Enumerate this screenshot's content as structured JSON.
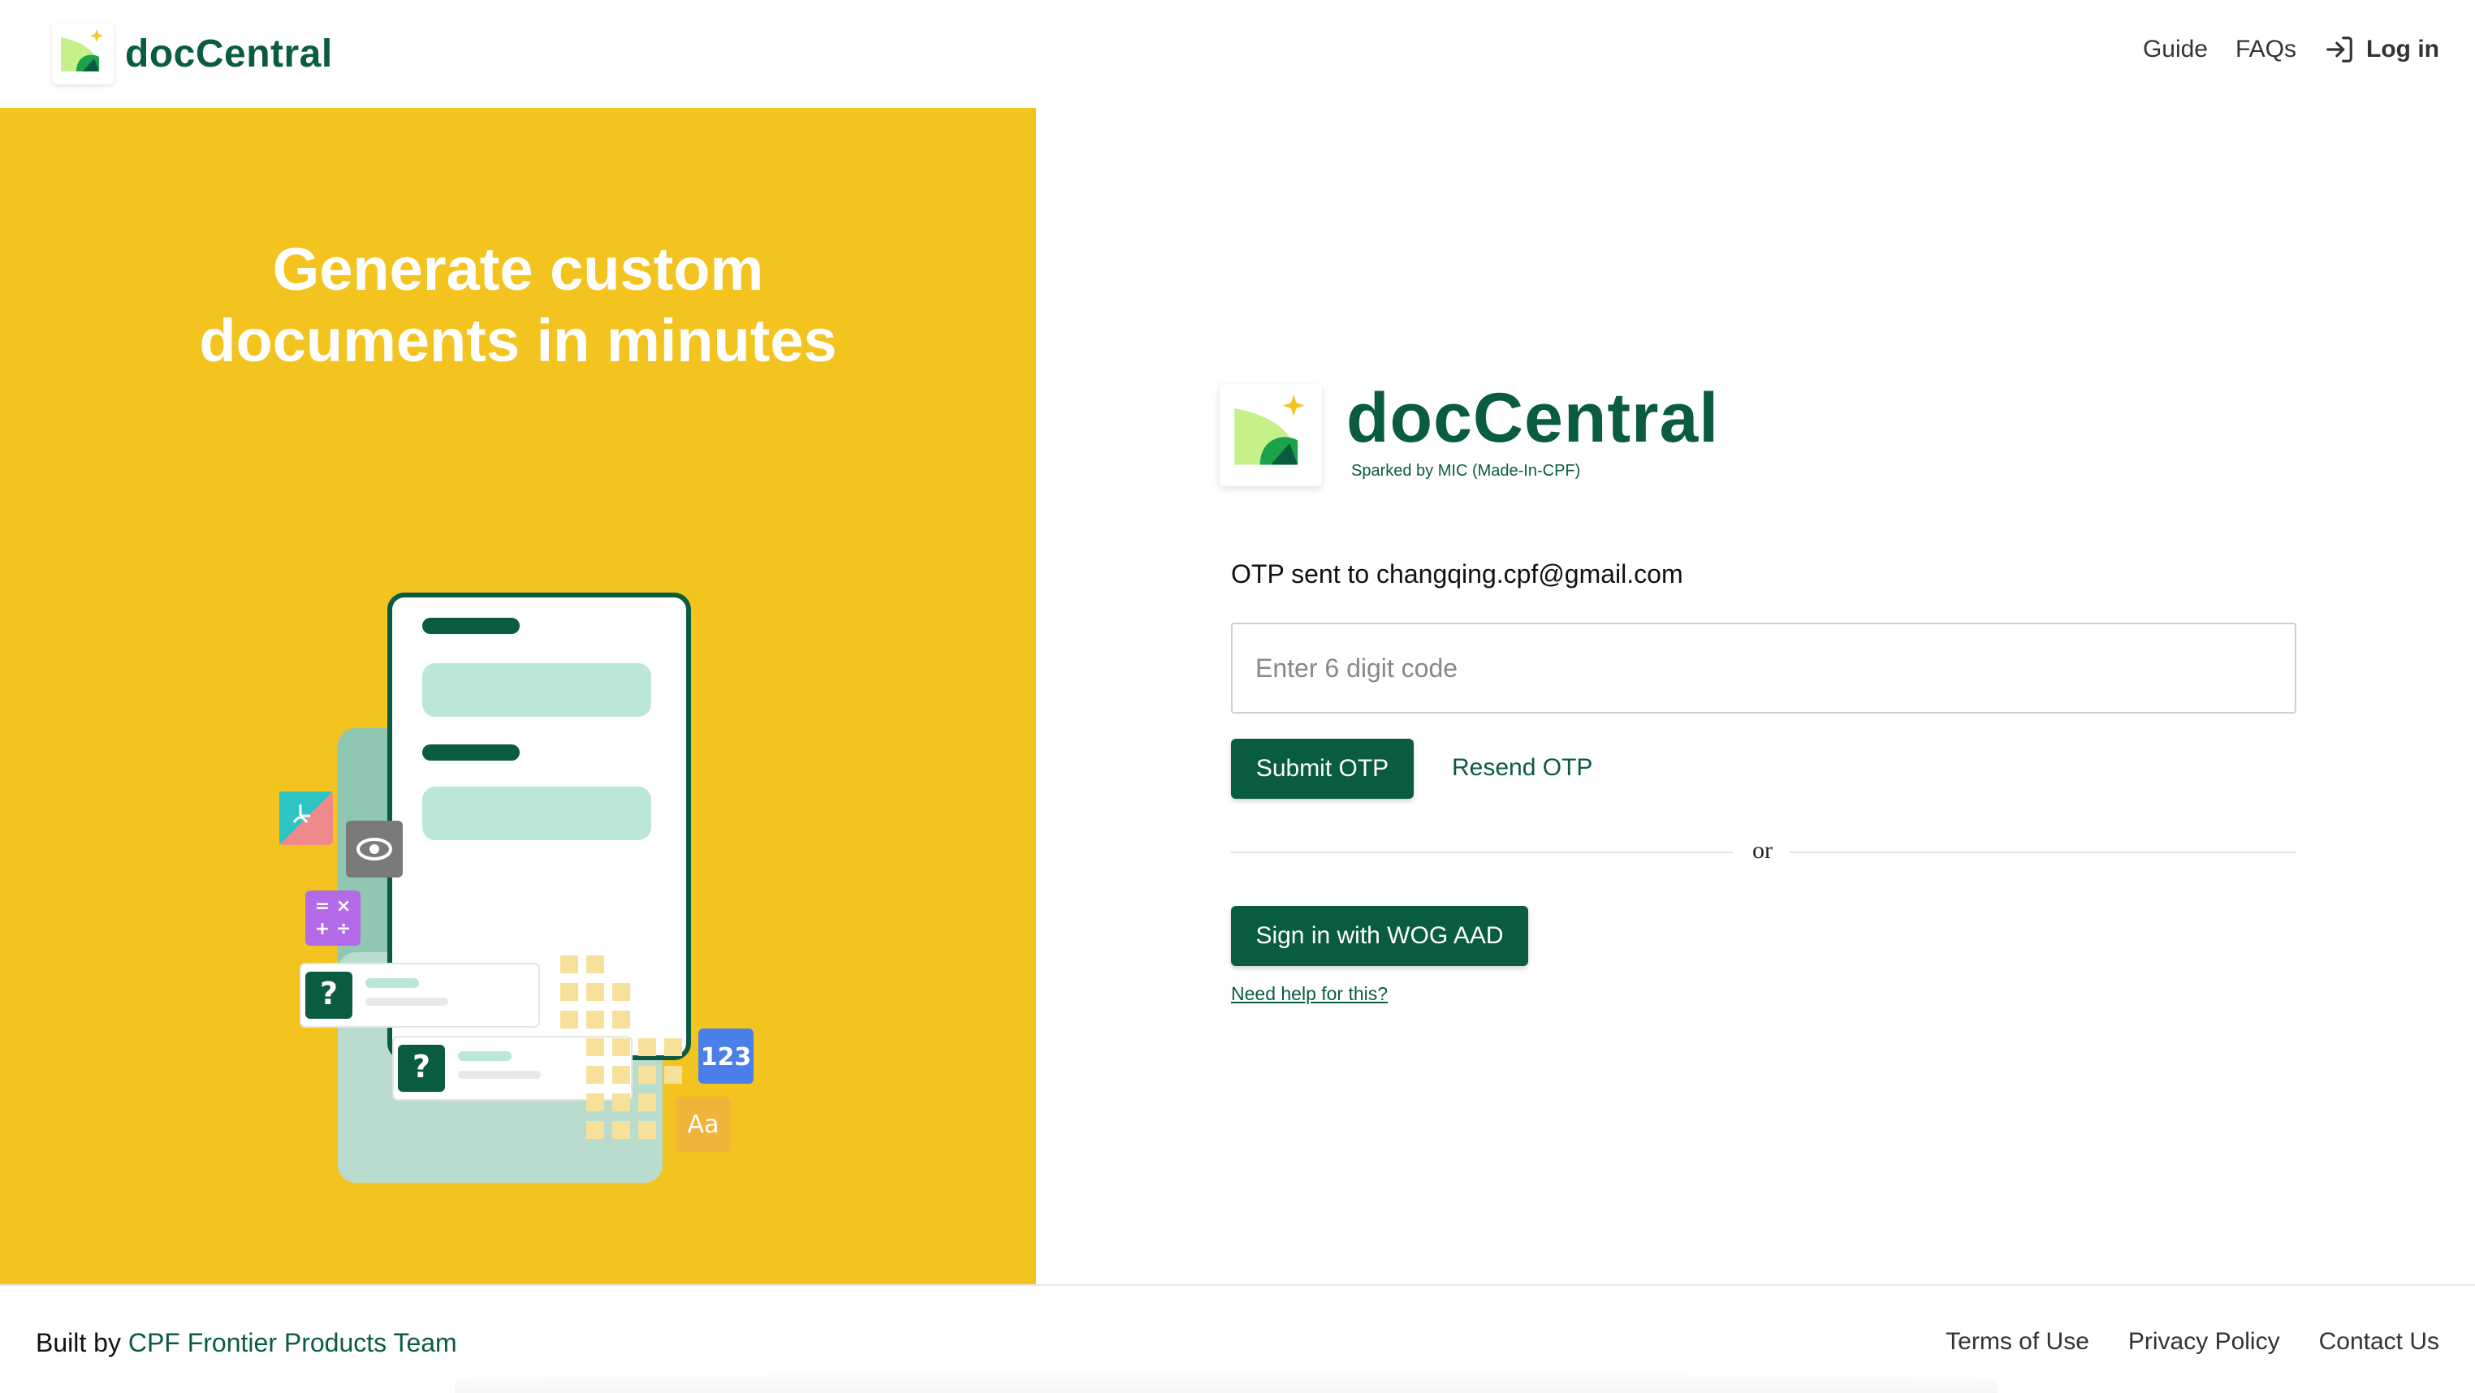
{
  "header": {
    "brand_name": "docCentral",
    "nav": {
      "guide": "Guide",
      "faqs": "FAQs",
      "login": "Log in"
    }
  },
  "hero": {
    "title_line1": "Generate custom",
    "title_line2": "documents in minutes",
    "illustration": {
      "badge_number": "123",
      "badge_text": "Aa",
      "question_mark": "?"
    }
  },
  "login_panel": {
    "brand_name": "docCentral",
    "brand_tagline": "Sparked by MIC (Made-In-CPF)",
    "otp_label": "OTP sent to changqing.cpf@gmail.com",
    "otp_placeholder": "Enter 6 digit code",
    "submit_label": "Submit OTP",
    "resend_label": "Resend OTP",
    "divider_text": "or",
    "wog_label": "Sign in with WOG AAD",
    "help_link": "Need help for this?"
  },
  "footer": {
    "built_prefix": "Built by",
    "built_team": "CPF Frontier Products Team",
    "links": [
      "Terms of Use",
      "Privacy Policy",
      "Contact Us"
    ]
  },
  "colors": {
    "brand_green": "#0a5c41",
    "hero_yellow": "#f3c320",
    "mint": "#bce6d9",
    "light_green": "#c5f08a"
  }
}
